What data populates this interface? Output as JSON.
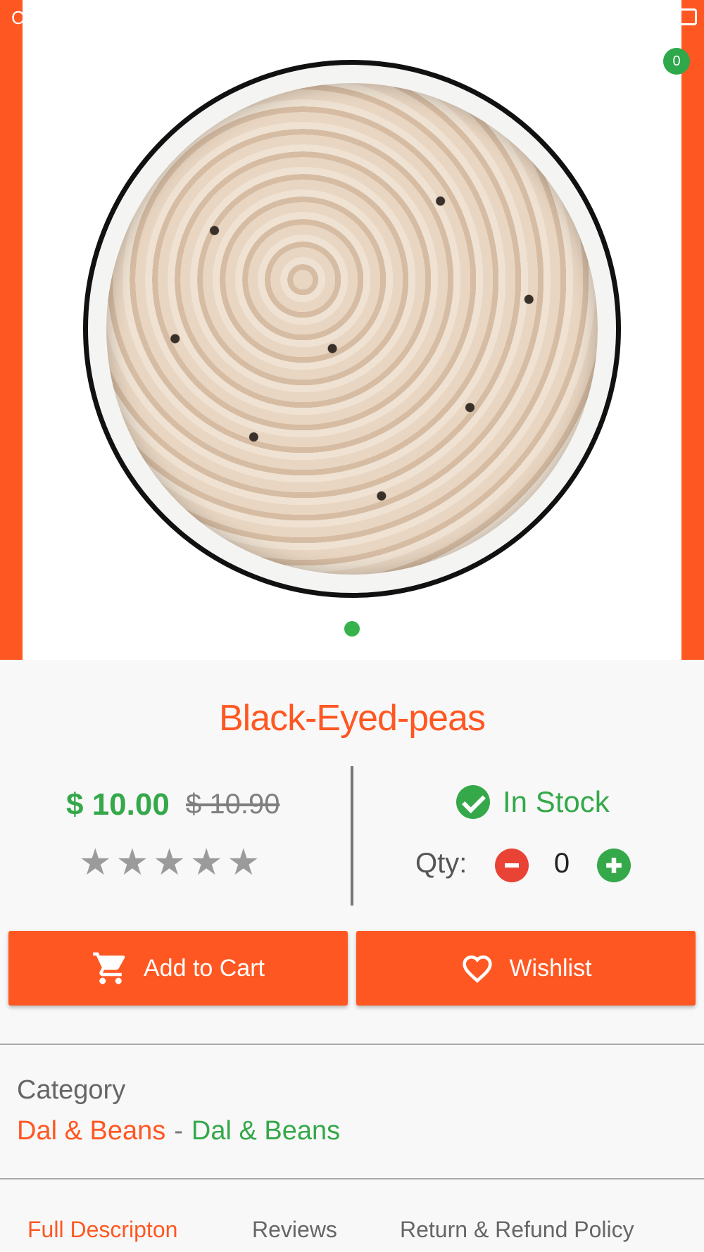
{
  "status": {
    "left_char": "C"
  },
  "cart": {
    "badge_count": "0"
  },
  "product": {
    "title": "Black-Eyed-peas",
    "price": "$ 10.00",
    "old_price": "$ 10.90",
    "rating_stars": "★★★★★",
    "rating_value": 0,
    "stock": "In Stock",
    "qty_label": "Qty:",
    "qty_value": "0"
  },
  "actions": {
    "add_to_cart": "Add to Cart",
    "wishlist": "Wishlist"
  },
  "category": {
    "label": "Category",
    "primary": "Dal & Beans",
    "separator": "-",
    "secondary": "Dal & Beans"
  },
  "tabs": [
    {
      "label": "Full Descripton",
      "active": true
    },
    {
      "label": "Reviews",
      "active": false
    },
    {
      "label": "Return & Refund Policy",
      "active": false
    }
  ],
  "colors": {
    "accent": "#ff5722",
    "green": "#35a84a",
    "red": "#e94335"
  },
  "icons": [
    "battery-icon",
    "check-circle-icon",
    "minus-icon",
    "plus-icon",
    "cart-icon",
    "heart-icon",
    "star-icon"
  ]
}
